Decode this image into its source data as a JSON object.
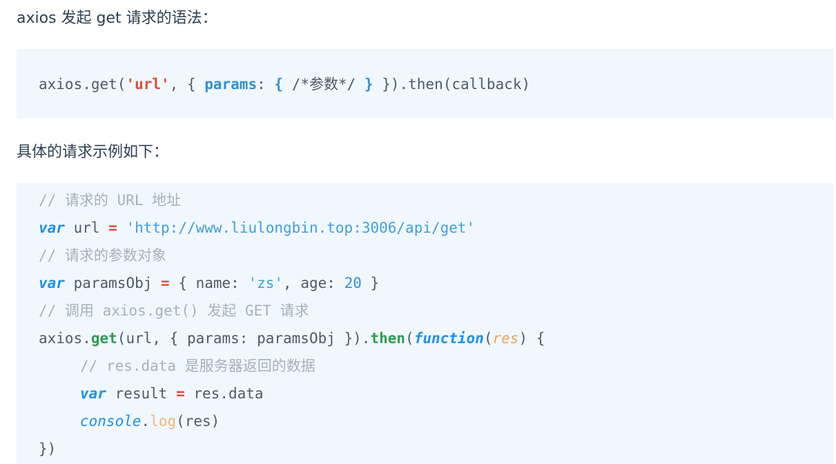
{
  "paragraph_1": "axios 发起 get 请求的语法：",
  "paragraph_2": "具体的请求示例如下：",
  "syntax": {
    "t1": "axios.get(",
    "t2": "'url'",
    "t3": ", { ",
    "t4": "params",
    "t5": ": ",
    "t6": "{",
    "t7": " /*参数*/ ",
    "t8": "}",
    "t9": " }).then(callback)"
  },
  "example": {
    "l1": {
      "comment": "// 请求的 URL 地址"
    },
    "l2": {
      "kw": "var",
      "a": " url ",
      "op": "=",
      "b": " ",
      "str": "'http://www.liulongbin.top:3006/api/get'"
    },
    "l3": {
      "comment": "// 请求的参数对象"
    },
    "l4": {
      "kw": "var",
      "a": " paramsObj ",
      "op": "=",
      "b": " { name: ",
      "str": "'zs'",
      "c": ", age: ",
      "num": "20",
      "d": " }"
    },
    "l5": {
      "comment": "// 调用 axios.get() 发起 GET 请求"
    },
    "l6": {
      "a": "axios.",
      "get": "get",
      "b": "(url, { params: paramsObj }).",
      "then": "then",
      "c": "(",
      "fn": "function",
      "d": "(",
      "res": "res",
      "e": ") {"
    },
    "l7": {
      "comment": "// res.data 是服务器返回的数据"
    },
    "l8": {
      "kw": "var",
      "a": " result ",
      "op": "=",
      "b": " res.data"
    },
    "l9": {
      "console": "console",
      "dot": ".",
      "log": "log",
      "a": "(res)"
    },
    "l10": {
      "text": "})"
    }
  }
}
